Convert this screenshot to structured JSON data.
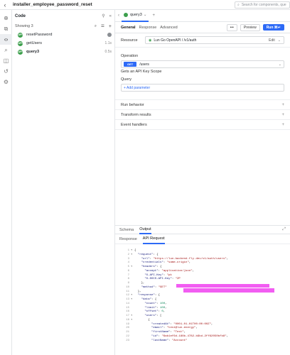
{
  "app": {
    "title": "installer_employee_password_reset",
    "search_placeholder": "Search for components, que"
  },
  "rail": {
    "icons": [
      "plus-circle-icon",
      "component-icon",
      "code-icon",
      "search-icon",
      "state-icon",
      "history-icon",
      "settings-icon"
    ]
  },
  "code_panel": {
    "title": "Code",
    "showing": "Showing 3",
    "items": [
      {
        "name": "resetPassword",
        "meta": ""
      },
      {
        "name": "getUsers",
        "meta": "1.1s"
      },
      {
        "name": "query3",
        "meta": "0.5s"
      }
    ]
  },
  "editor": {
    "tab_label": "query3",
    "subtabs": [
      "General",
      "Response",
      "Advanced"
    ],
    "preview_label": "Preview",
    "run_label": "Run ⌘↵",
    "more_label": "•••",
    "resource_label": "Resource",
    "resource_value": "Lun Go OpenAPI / /v1/auth",
    "edit_label": "Edit",
    "operation_label": "Operation",
    "method": "GET",
    "operation_path": "/users",
    "operation_desc": "Gets an API Key Scope",
    "query_label": "Query",
    "add_param": "+ Add parameter",
    "sections": [
      "Run behavior",
      "Transform results",
      "Event handlers"
    ]
  },
  "results": {
    "tabs": [
      "Schema",
      "Output"
    ],
    "subtabs": [
      "Response",
      "API Request"
    ],
    "code_lines": [
      {
        "n": "1",
        "f": "▾",
        "segs": [
          {
            "c": "tx",
            "t": "{"
          }
        ]
      },
      {
        "n": "2",
        "f": "▾",
        "segs": [
          {
            "c": "tx",
            "t": "  "
          },
          {
            "c": "key",
            "t": "\"request\""
          },
          {
            "c": "tx",
            "t": ": {"
          }
        ]
      },
      {
        "n": "3",
        "f": "",
        "segs": [
          {
            "c": "tx",
            "t": "    "
          },
          {
            "c": "key",
            "t": "\"url\""
          },
          {
            "c": "tx",
            "t": ": "
          },
          {
            "c": "str",
            "t": "\"https://lun-backend.fly.dev/v1/auth/users\""
          },
          {
            "c": "tx",
            "t": ","
          }
        ]
      },
      {
        "n": "4",
        "f": "",
        "segs": [
          {
            "c": "tx",
            "t": "    "
          },
          {
            "c": "key",
            "t": "\"credentials\""
          },
          {
            "c": "tx",
            "t": ": "
          },
          {
            "c": "str",
            "t": "\"same-origin\""
          },
          {
            "c": "tx",
            "t": ","
          }
        ]
      },
      {
        "n": "5",
        "f": "▾",
        "segs": [
          {
            "c": "tx",
            "t": "    "
          },
          {
            "c": "key",
            "t": "\"headers\""
          },
          {
            "c": "tx",
            "t": ": {"
          }
        ]
      },
      {
        "n": "6",
        "f": "",
        "segs": [
          {
            "c": "tx",
            "t": "      "
          },
          {
            "c": "key",
            "t": "\"accept\""
          },
          {
            "c": "tx",
            "t": ": "
          },
          {
            "c": "str",
            "t": "\"application/json\""
          },
          {
            "c": "tx",
            "t": ","
          }
        ]
      },
      {
        "n": "7",
        "f": "",
        "segs": [
          {
            "c": "tx",
            "t": "      "
          },
          {
            "c": "key",
            "t": "\"X-API-Key\""
          },
          {
            "c": "tx",
            "t": ": "
          },
          {
            "c": "str",
            "t": "\"pk"
          }
        ]
      },
      {
        "n": "8",
        "f": "",
        "segs": [
          {
            "c": "tx",
            "t": "      "
          },
          {
            "c": "key",
            "t": "\"X-DOCS-API-Key\""
          },
          {
            "c": "tx",
            "t": ": "
          },
          {
            "c": "str",
            "t": "\"ZP"
          }
        ]
      },
      {
        "n": "9",
        "f": "",
        "segs": [
          {
            "c": "tx",
            "t": "    },"
          }
        ]
      },
      {
        "n": "10",
        "f": "",
        "segs": [
          {
            "c": "tx",
            "t": "    "
          },
          {
            "c": "key",
            "t": "\"method\""
          },
          {
            "c": "tx",
            "t": ": "
          },
          {
            "c": "str",
            "t": "\"GET\""
          }
        ]
      },
      {
        "n": "11",
        "f": "",
        "segs": [
          {
            "c": "tx",
            "t": "  },"
          }
        ]
      },
      {
        "n": "12",
        "f": "▾",
        "segs": [
          {
            "c": "tx",
            "t": "  "
          },
          {
            "c": "key",
            "t": "\"response\""
          },
          {
            "c": "tx",
            "t": ": {"
          }
        ]
      },
      {
        "n": "13",
        "f": "▾",
        "segs": [
          {
            "c": "tx",
            "t": "    "
          },
          {
            "c": "key",
            "t": "\"data\""
          },
          {
            "c": "tx",
            "t": ": {"
          }
        ]
      },
      {
        "n": "14",
        "f": "",
        "segs": [
          {
            "c": "tx",
            "t": "      "
          },
          {
            "c": "key",
            "t": "\"count\""
          },
          {
            "c": "tx",
            "t": ": "
          },
          {
            "c": "num",
            "t": "100"
          },
          {
            "c": "tx",
            "t": ","
          }
        ]
      },
      {
        "n": "15",
        "f": "",
        "segs": [
          {
            "c": "tx",
            "t": "      "
          },
          {
            "c": "key",
            "t": "\"limit\""
          },
          {
            "c": "tx",
            "t": ": "
          },
          {
            "c": "num",
            "t": "100"
          },
          {
            "c": "tx",
            "t": ","
          }
        ]
      },
      {
        "n": "16",
        "f": "",
        "segs": [
          {
            "c": "tx",
            "t": "      "
          },
          {
            "c": "key",
            "t": "\"offset\""
          },
          {
            "c": "tx",
            "t": ": "
          },
          {
            "c": "num",
            "t": "0"
          },
          {
            "c": "tx",
            "t": ","
          }
        ]
      },
      {
        "n": "17",
        "f": "▾",
        "segs": [
          {
            "c": "tx",
            "t": "      "
          },
          {
            "c": "key",
            "t": "\"users\""
          },
          {
            "c": "tx",
            "t": ": ["
          }
        ]
      },
      {
        "n": "18",
        "f": "▾",
        "segs": [
          {
            "c": "tx",
            "t": "        {"
          }
        ]
      },
      {
        "n": "19",
        "f": "",
        "segs": [
          {
            "c": "tx",
            "t": "          "
          },
          {
            "c": "key",
            "t": "\"createdAt\""
          },
          {
            "c": "tx",
            "t": ": "
          },
          {
            "c": "str",
            "t": "\"0001-01-01T00:00:00Z\""
          },
          {
            "c": "tx",
            "t": ","
          }
        ]
      },
      {
        "n": "20",
        "f": "",
        "segs": [
          {
            "c": "tx",
            "t": "          "
          },
          {
            "c": "key",
            "t": "\"email\""
          },
          {
            "c": "tx",
            "t": ": "
          },
          {
            "c": "str",
            "t": "\"test@lun.energy\""
          },
          {
            "c": "tx",
            "t": ","
          }
        ]
      },
      {
        "n": "21",
        "f": "",
        "segs": [
          {
            "c": "tx",
            "t": "          "
          },
          {
            "c": "key",
            "t": "\"firstName\""
          },
          {
            "c": "tx",
            "t": ": "
          },
          {
            "c": "str",
            "t": "\"Test\""
          },
          {
            "c": "tx",
            "t": ","
          }
        ]
      },
      {
        "n": "22",
        "f": "",
        "segs": [
          {
            "c": "tx",
            "t": "          "
          },
          {
            "c": "key",
            "t": "\"id\""
          },
          {
            "c": "tx",
            "t": ": "
          },
          {
            "c": "str",
            "t": "\"6ab1ef6d-188b-4782-b9bd-2ff62050bfb8\""
          },
          {
            "c": "tx",
            "t": ","
          }
        ]
      },
      {
        "n": "23",
        "f": "",
        "segs": [
          {
            "c": "tx",
            "t": "          "
          },
          {
            "c": "key",
            "t": "\"lastName\""
          },
          {
            "c": "tx",
            "t": ": "
          },
          {
            "c": "str",
            "t": "\"Account\""
          }
        ]
      }
    ]
  },
  "colors": {
    "accent": "#2d6af6",
    "success": "#3c9f4c",
    "redaction": "#f25df2"
  }
}
